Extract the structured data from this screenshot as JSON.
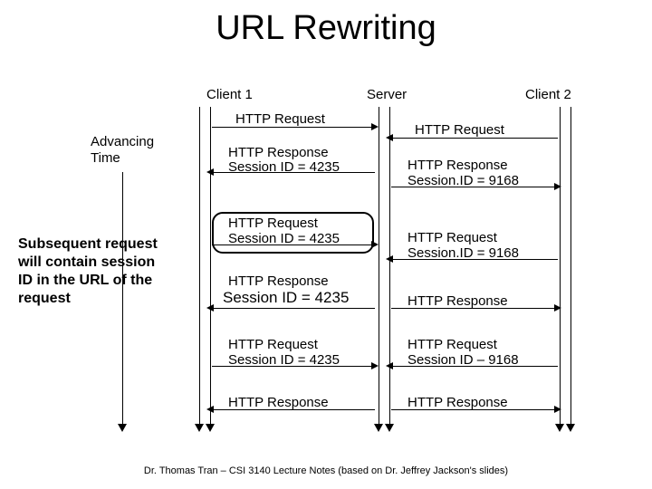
{
  "title": "URL Rewriting",
  "annotation": "Subsequent request will contain session ID in the URL of the request",
  "footer": "Dr. Thomas Tran – CSI 3140 Lecture Notes (based on Dr. Jeffrey Jackson's slides)",
  "labels": {
    "advancing": "Advancing",
    "time": "Time",
    "client1": "Client 1",
    "server": "Server",
    "client2": "Client 2",
    "httpRequest": "HTTP Request",
    "httpResponse": "HTTP Response",
    "sid4235": "Session ID = 4235",
    "sid9168": "Session.ID = 9168",
    "sidG9168": "Session ID – 9168",
    "sidB4235": "Session ID = 4235"
  }
}
